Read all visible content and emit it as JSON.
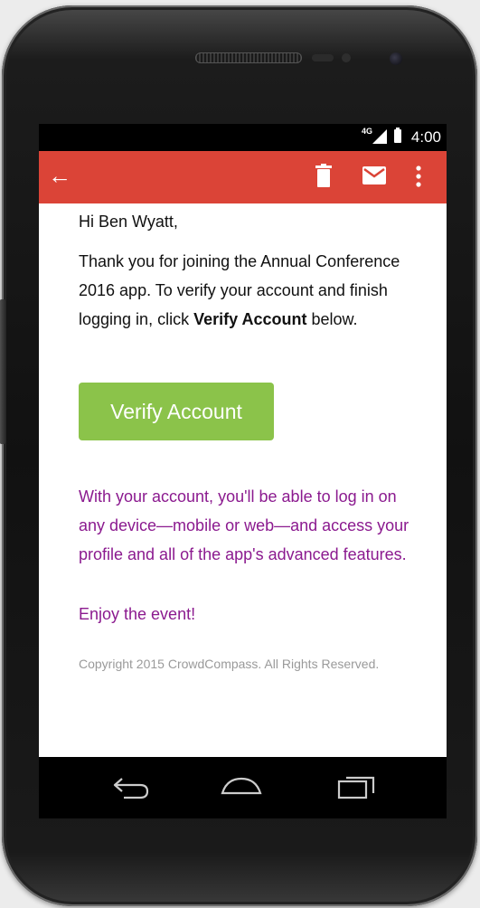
{
  "status_bar": {
    "network": "4G",
    "time": "4:00"
  },
  "app_bar": {
    "icons": [
      "arrow-back-icon",
      "trash-icon",
      "mail-icon",
      "more-vertical-icon"
    ],
    "color": "#db4437"
  },
  "email": {
    "greeting": "Hi Ben Wyatt,",
    "intro_text": "Thank you for joining the Annual Conference 2016 app. To verify your account and finish logging in, click",
    "intro_bold": "Verify Account",
    "intro_end": " below.",
    "verify_button_label": "Verify Account",
    "verify_button_color": "#8bc34a",
    "account_text": "With your account, you'll be able to log in on any device—mobile or web—and access your profile and all of the app's advanced features.",
    "enjoy_text": "Enjoy the event!",
    "accent_color": "#8b1a8f",
    "copyright": "Copyright 2015 CrowdCompass. All Rights Reserved."
  },
  "nav_bar": {
    "icons": [
      "nav-back-icon",
      "nav-home-icon",
      "nav-recent-apps-icon"
    ]
  }
}
